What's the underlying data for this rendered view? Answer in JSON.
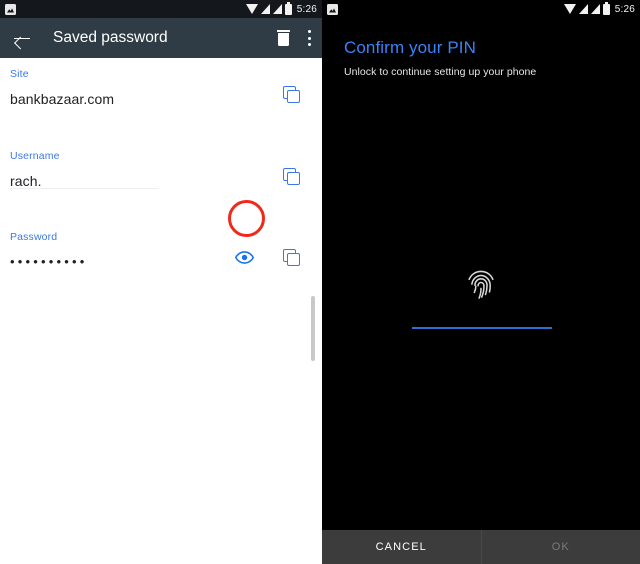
{
  "status_bar": {
    "notification_icon": "screenshot-icon",
    "wifi_icon": "wifi-icon",
    "signal_icon_1": "signal-bars-icon",
    "signal_icon_2": "signal-bars-icon",
    "battery_icon": "battery-icon",
    "time": "5:26"
  },
  "left_screen": {
    "app_bar": {
      "back_icon": "back-arrow-icon",
      "title": "Saved password",
      "delete_icon": "trash-icon",
      "overflow_icon": "more-vert-icon"
    },
    "fields": [
      {
        "label": "Site",
        "value": "bankbazaar.com",
        "copy_icon": "copy-icon"
      },
      {
        "label": "Username",
        "value": "rach.",
        "copy_icon": "copy-icon"
      },
      {
        "label": "Password",
        "value": "••••••••••",
        "reveal_icon": "eye-icon",
        "copy_icon": "copy-icon"
      }
    ],
    "annotation": {
      "shape": "circle",
      "color": "#ef2a1b",
      "target": "reveal-password-eye-icon"
    },
    "scrollbar": "vertical-scrollbar"
  },
  "right_screen": {
    "title": "Confirm your PIN",
    "subtitle": "Unlock to continue setting up your phone",
    "fingerprint_icon": "fingerprint-icon",
    "pin_input_value": "",
    "pin_input_placeholder": "",
    "buttons": {
      "cancel": "CANCEL",
      "ok": "OK"
    }
  },
  "colors": {
    "status_bar_bg": "#14181c",
    "app_bar_bg": "#2f3c45",
    "accent_blue": "#3b78e7",
    "pin_title_blue": "#3b82f5",
    "pin_line_blue": "#2f6fd0",
    "annotation_red": "#ef2a1b",
    "bottom_bar_bg": "#3c3c3c"
  }
}
